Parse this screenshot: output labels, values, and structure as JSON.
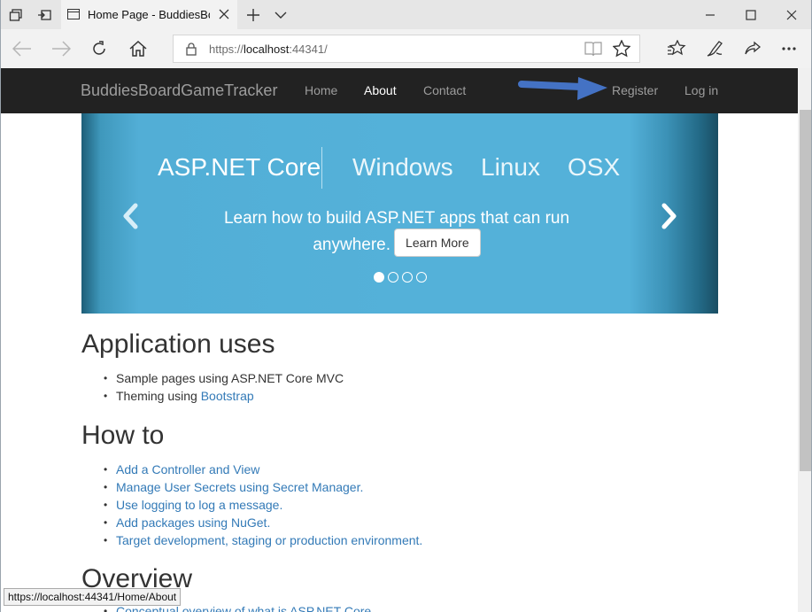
{
  "browser": {
    "tab_title": "Home Page - BuddiesBoardGameTracker",
    "url_scheme": "https://",
    "url_host": "localhost",
    "url_rest": ":44341/",
    "icons": [
      "set-aside-tabs-icon",
      "tab-preview-icon",
      "page-icon",
      "close-icon",
      "new-tab-icon",
      "tab-list-chevron-icon",
      "minimize-icon",
      "maximize-icon",
      "window-close-icon",
      "back-icon",
      "forward-icon",
      "refresh-icon",
      "home-icon",
      "lock-icon",
      "reading-view-icon",
      "favorite-star-icon",
      "favorites-hub-icon",
      "pen-icon",
      "share-icon",
      "more-icon"
    ]
  },
  "site": {
    "brand": "BuddiesBoardGameTracker",
    "nav": [
      {
        "label": "Home"
      },
      {
        "label": "About"
      },
      {
        "label": "Contact"
      }
    ],
    "register": "Register",
    "login": "Log in"
  },
  "carousel": {
    "logo_main": "ASP.NET Core",
    "logo_windows": "Windows",
    "logo_linux": "Linux",
    "logo_osx": "OSX",
    "caption": "Learn how to build ASP.NET apps that can run anywhere.",
    "button": "Learn More",
    "slides_count": 4,
    "active_slide": 1
  },
  "sections": {
    "uses": {
      "title": "Application uses",
      "item1": "Sample pages using ASP.NET Core MVC",
      "item2_text": "Theming using ",
      "item2_link": "Bootstrap"
    },
    "howto": {
      "title": "How to",
      "items": [
        "Add a Controller and View",
        "Manage User Secrets using Secret Manager.",
        "Use logging to log a message.",
        "Add packages using NuGet.",
        "Target development, staging or production environment."
      ]
    },
    "overview": {
      "title": "Overview",
      "item1": "Conceptual overview of what is ASP.NET Core"
    }
  },
  "status_url": "https://localhost:44341/Home/About",
  "colors": {
    "site_navbar": "#222222",
    "carousel": "#54b1d9",
    "link": "#337ab7",
    "annotation_arrow": "#4472c4"
  }
}
